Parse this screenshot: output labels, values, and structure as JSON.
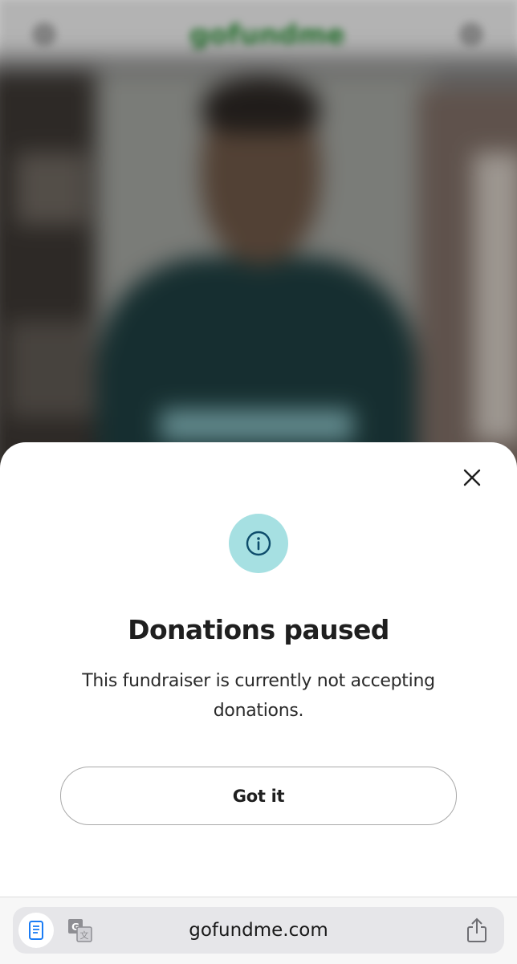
{
  "background": {
    "logo_text": "gofundme"
  },
  "modal": {
    "title": "Donations paused",
    "message": "This fundraiser is currently not accepting donations.",
    "button_label": "Got it",
    "icons": {
      "close": "close-icon",
      "info": "info-icon"
    },
    "colors": {
      "info_circle": "#a6e0e2",
      "info_icon": "#0d4c6b"
    }
  },
  "browser": {
    "url": "gofundme.com",
    "icons": {
      "reader": "reader-mode-icon",
      "translate": "translate-icon",
      "share": "share-icon"
    },
    "colors": {
      "reader_icon": "#1a7cf5"
    }
  }
}
